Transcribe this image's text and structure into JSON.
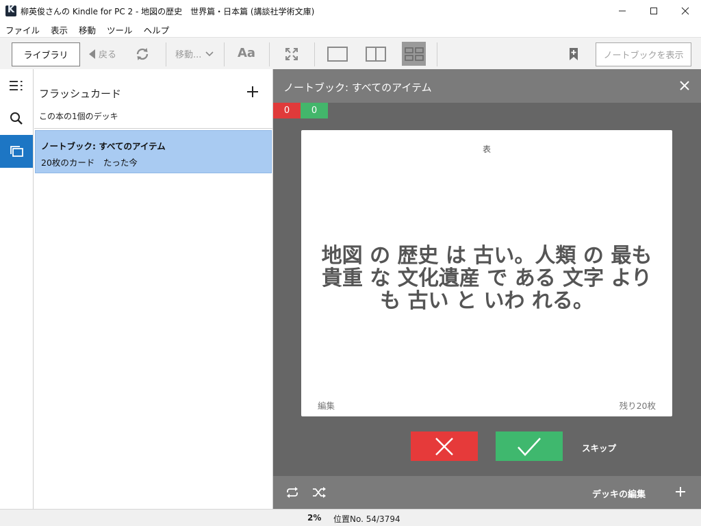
{
  "window": {
    "title": "柳英俊さんの Kindle for PC 2 - 地図の歴史　世界篇・日本篇 (講談社学術文庫)"
  },
  "menubar": {
    "items": [
      "ファイル",
      "表示",
      "移動",
      "ツール",
      "ヘルプ"
    ]
  },
  "toolbar": {
    "library_label": "ライブラリ",
    "back_label": "戻る",
    "goto_label": "移動...",
    "font_label": "Aa",
    "notebook_label": "ノートブックを表示"
  },
  "flashcards": {
    "title": "フラッシュカード",
    "subtitle": "この本の1個のデッキ",
    "decks": [
      {
        "name": "ノートブック: すべてのアイテム",
        "meta": "20枚のカード　たった今"
      }
    ]
  },
  "card_view": {
    "header_title": "ノートブック: すべてのアイテム",
    "wrong_count": "0",
    "right_count": "0",
    "card_side": "表",
    "card_text": "地図 の 歴史 は 古い。人類 の 最も 貴重 な 文化遺産 で ある 文字 よりも 古い と いわ れる。",
    "edit_label": "編集",
    "remaining_label": "残り20枚",
    "skip_label": "スキップ",
    "edit_deck_label": "デッキの編集"
  },
  "statusbar": {
    "percent": "2%",
    "location": "位置No. 54/3794"
  },
  "colors": {
    "accent": "#1d76c4",
    "selected_row": "#a9cbf2",
    "wrong": "#e63a3a",
    "right": "#3fb86e",
    "panel_dark": "#666666"
  }
}
